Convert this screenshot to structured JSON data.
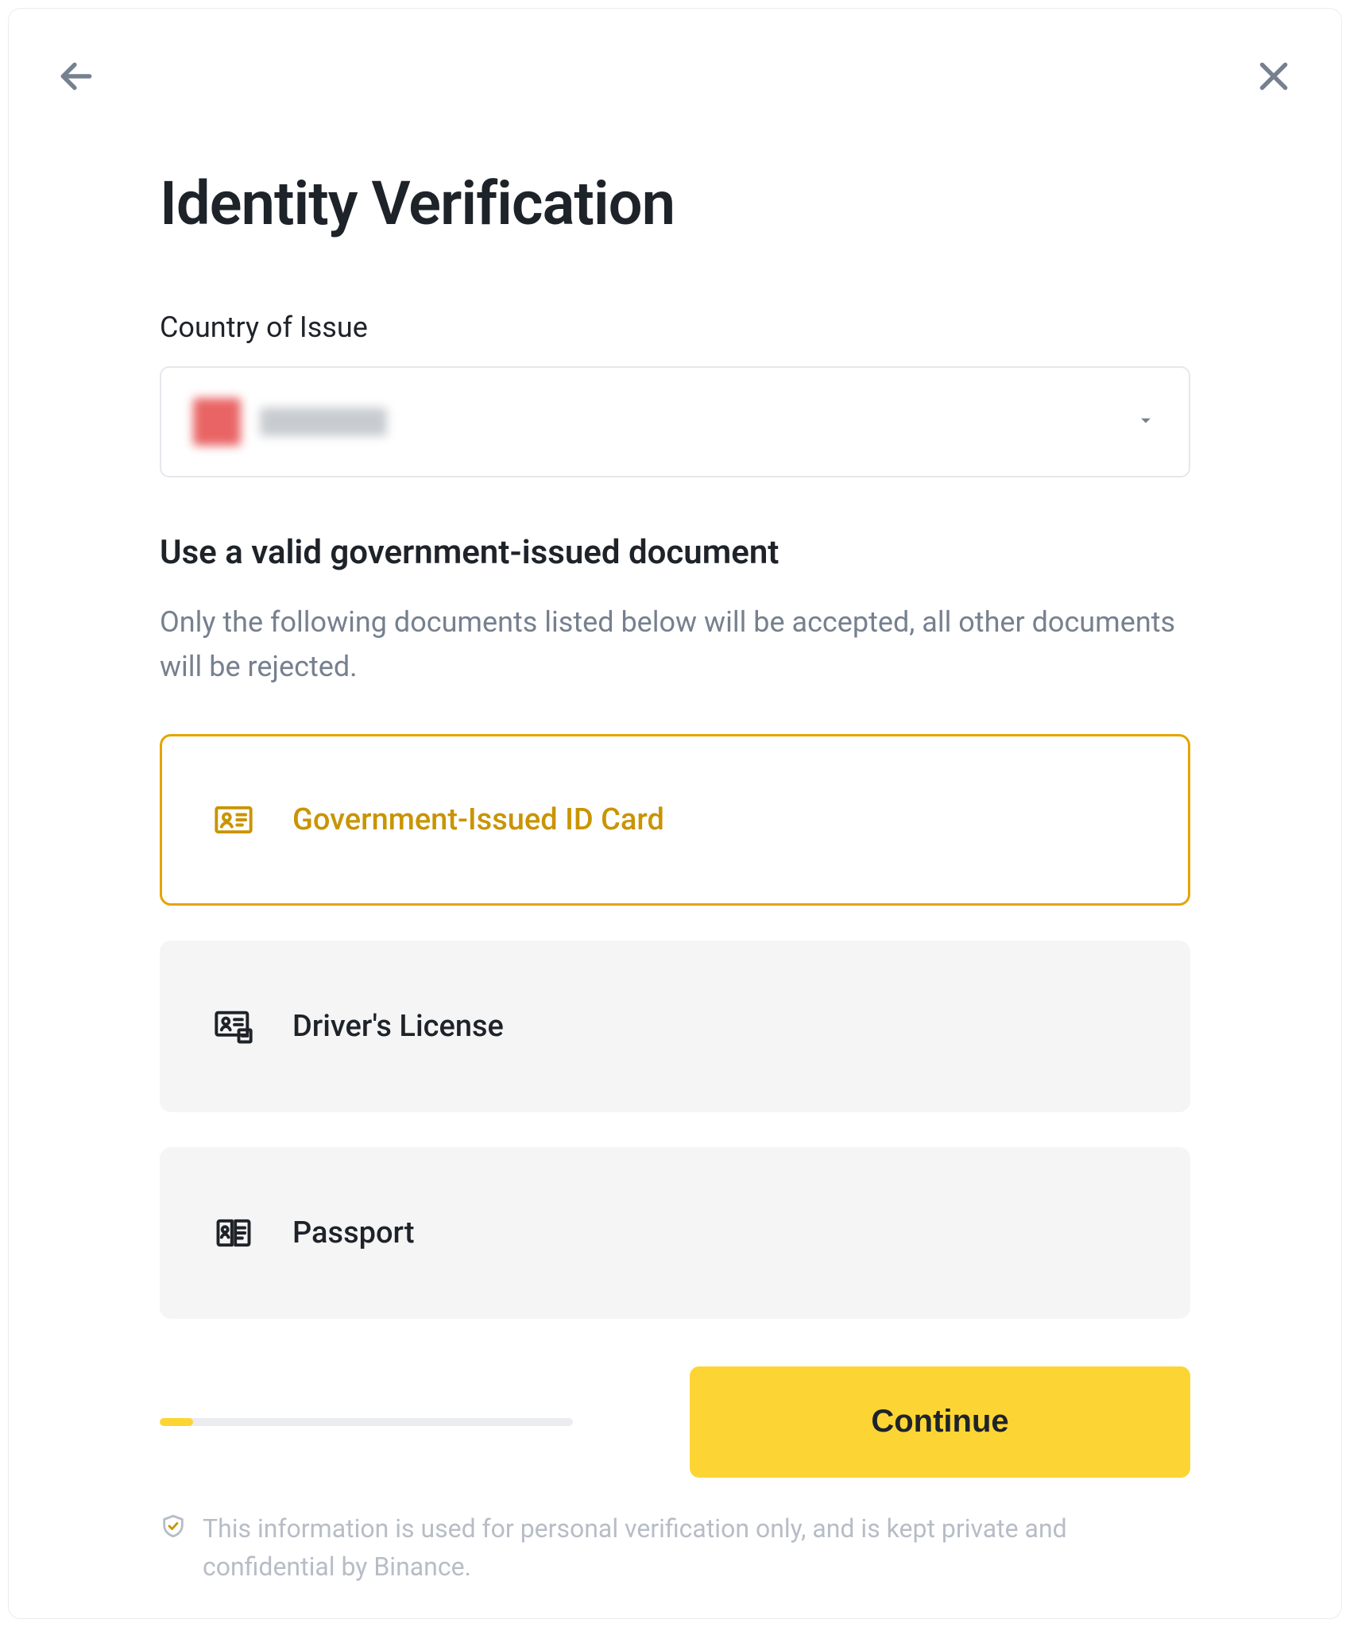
{
  "header": {
    "title": "Identity Verification"
  },
  "country": {
    "label": "Country of Issue",
    "selected_value_redacted": true
  },
  "document_section": {
    "heading": "Use a valid government-issued document",
    "subheading": "Only the following documents listed below will be accepted, all other documents will be rejected."
  },
  "options": [
    {
      "id": "id-card",
      "label": "Government-Issued ID Card",
      "selected": true
    },
    {
      "id": "drivers-license",
      "label": "Driver's License",
      "selected": false
    },
    {
      "id": "passport",
      "label": "Passport",
      "selected": false
    }
  ],
  "progress": {
    "percent": 8
  },
  "actions": {
    "continue_label": "Continue"
  },
  "disclaimer": {
    "text": "This information is used for personal verification only, and is kept private and confidential by Binance."
  },
  "colors": {
    "accent": "#fcd535",
    "accent_dark": "#c99400",
    "text": "#1e2329",
    "muted": "#76808f",
    "border": "#eaecef",
    "option_bg": "#f5f5f5"
  }
}
